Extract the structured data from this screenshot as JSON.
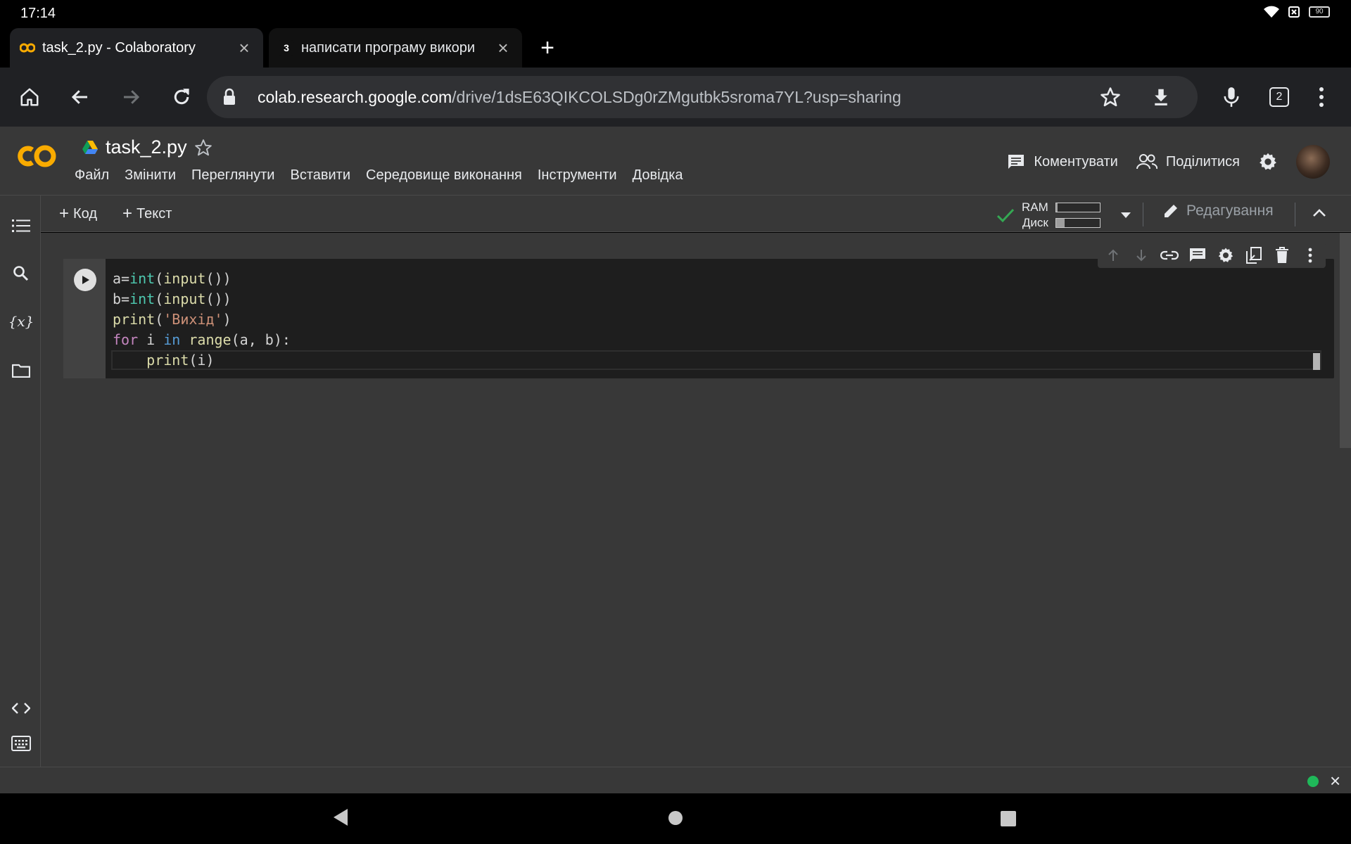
{
  "status": {
    "time": "17:14",
    "battery": "90"
  },
  "tabs": [
    {
      "title": "task_2.py - Colaboratory",
      "favicon": "colab-logo"
    },
    {
      "title": "написати програму викори",
      "favicon": "3"
    }
  ],
  "toolbar": {
    "url_host": "colab.research.google.com",
    "url_path": "/drive/1dsE63QIKCOLSDg0rZMgutbk5sroma7YL?usp=sharing",
    "tab_count": "2"
  },
  "colab": {
    "doc_name": "task_2.py",
    "menu": [
      "Файл",
      "Змінити",
      "Переглянути",
      "Вставити",
      "Середовище виконання",
      "Інструменти",
      "Довідка"
    ],
    "comment_label": "Коментувати",
    "share_label": "Поділитися",
    "add_code_label": "Код",
    "add_text_label": "Текст",
    "ram_label": "RAM",
    "disk_label": "Диск",
    "ram_usage": 0.04,
    "disk_usage": 0.2,
    "edit_label": "Редагування"
  },
  "cell": {
    "code_lines": [
      "a=int(input())",
      "b=int(input())",
      "print('Вихід')",
      "for i in range(a, b):",
      "    print(i)"
    ]
  },
  "colors": {
    "accent_orange": "#F9AB00",
    "status_green": "#1FB859",
    "connected_check": "#34A853"
  }
}
